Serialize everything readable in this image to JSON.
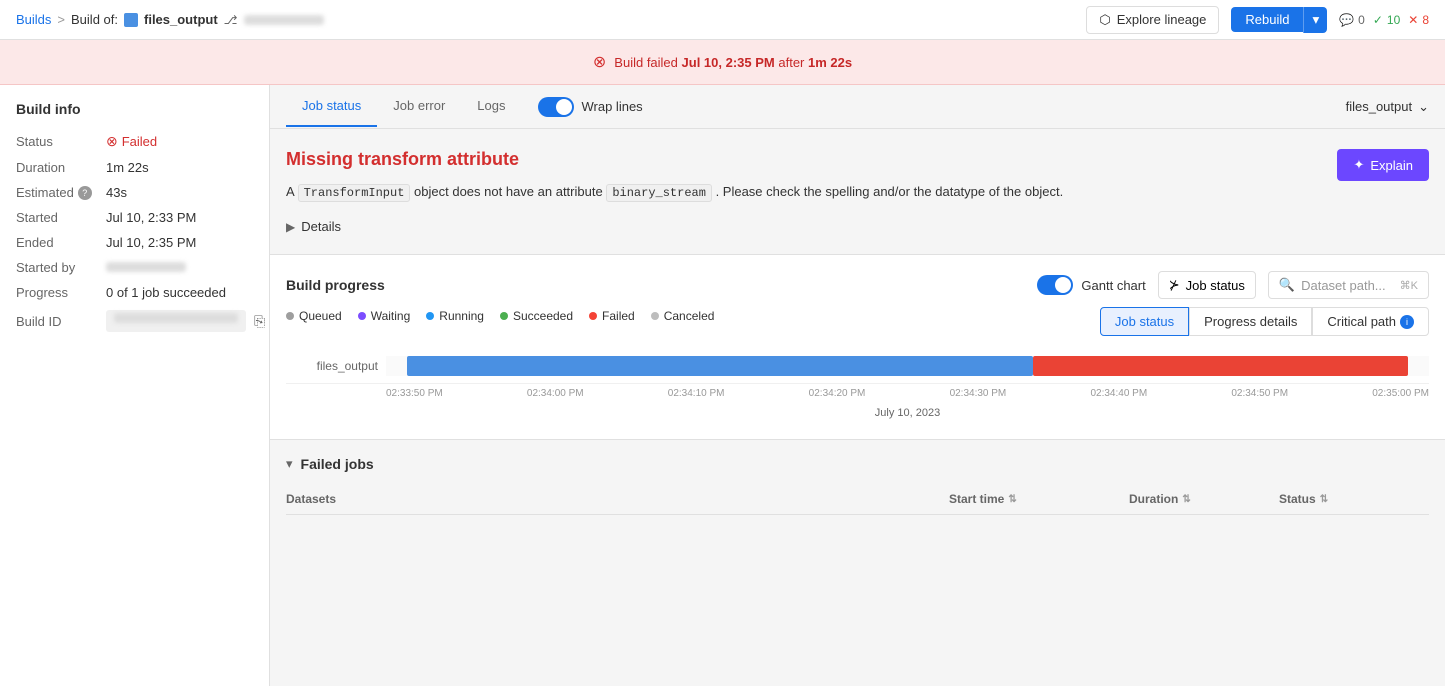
{
  "header": {
    "breadcrumb_builds": "Builds",
    "breadcrumb_sep": ">",
    "build_of_label": "Build of:",
    "file_name": "files_output",
    "explore_lineage": "Explore lineage",
    "rebuild_label": "Rebuild",
    "badge_comment": "0",
    "badge_check": "10",
    "badge_x": "8"
  },
  "error_banner": {
    "message_prefix": "Build failed",
    "date": "Jul 10, 2:35 PM",
    "message_mid": "after",
    "duration": "1m 22s"
  },
  "sidebar": {
    "title": "Build info",
    "status_label": "Status",
    "status_value": "Failed",
    "duration_label": "Duration",
    "duration_value": "1m 22s",
    "estimated_label": "Estimated",
    "estimated_value": "43s",
    "started_label": "Started",
    "started_value": "Jul 10, 2:33 PM",
    "ended_label": "Ended",
    "ended_value": "Jul 10, 2:35 PM",
    "started_by_label": "Started by",
    "progress_label": "Progress",
    "progress_value": "0 of 1 job succeeded",
    "build_id_label": "Build ID"
  },
  "tabs": {
    "job_status": "Job status",
    "job_error": "Job error",
    "logs": "Logs",
    "wrap_lines": "Wrap lines",
    "file_label": "files_output"
  },
  "job_error": {
    "title": "Missing transform attribute",
    "desc_prefix": "A",
    "code1": "TransformInput",
    "desc_mid": "object does not have an attribute",
    "code2": "binary_stream",
    "desc_suffix": ". Please check the spelling and/or the datatype of the object.",
    "details_label": "Details",
    "explain_label": "Explain",
    "explain_icon": "✦"
  },
  "build_progress": {
    "title": "Build progress",
    "gantt_label": "Gantt chart",
    "filter_label": "Job status",
    "search_placeholder": "Dataset path...",
    "search_shortcut": "⌘K",
    "legend": [
      {
        "label": "Queued",
        "color": "#9e9e9e"
      },
      {
        "label": "Waiting",
        "color": "#7c4dff"
      },
      {
        "label": "Running",
        "color": "#2196f3"
      },
      {
        "label": "Succeeded",
        "color": "#4caf50"
      },
      {
        "label": "Failed",
        "color": "#f44336"
      },
      {
        "label": "Canceled",
        "color": "#bdbdbd"
      }
    ],
    "view_tabs": [
      {
        "label": "Job status",
        "active": true
      },
      {
        "label": "Progress details",
        "active": false
      },
      {
        "label": "Critical path",
        "active": false,
        "info": true
      }
    ],
    "gantt_row_label": "files_output",
    "times": [
      "02:33:50 PM",
      "02:34:00 PM",
      "02:34:10 PM",
      "02:34:20 PM",
      "02:34:30 PM",
      "02:34:40 PM",
      "02:34:50 PM",
      "02:35:00 PM"
    ],
    "date_label": "July 10, 2023"
  },
  "failed_jobs": {
    "title": "Failed jobs",
    "col_datasets": "Datasets",
    "col_start": "Start time",
    "col_duration": "Duration",
    "col_status": "Status"
  }
}
